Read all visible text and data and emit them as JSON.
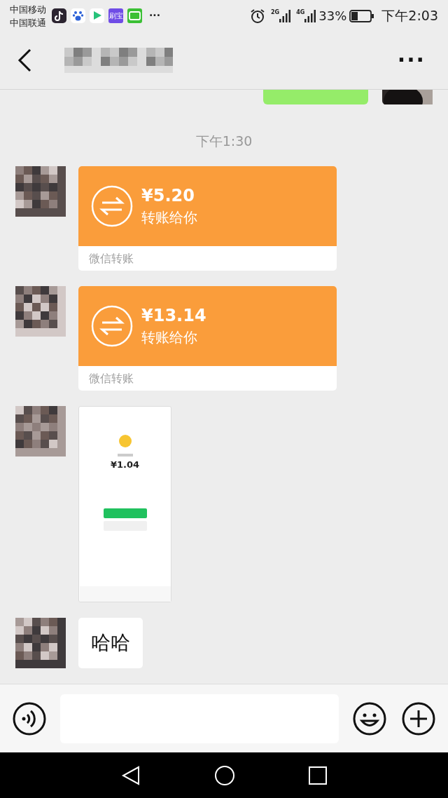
{
  "status_bar": {
    "carriers": [
      "中国移动",
      "中国联通"
    ],
    "apps": [
      {
        "kind": "music"
      },
      {
        "kind": "paw"
      },
      {
        "kind": "play"
      },
      {
        "kind": "label",
        "text": "刷宝"
      },
      {
        "kind": "tv"
      }
    ],
    "more": "···",
    "networks": [
      "2G",
      "4G"
    ],
    "battery": "33%",
    "time": "下午2:03"
  },
  "header": {
    "menu": "···"
  },
  "messages": [
    {
      "kind": "partial",
      "outgoing": true
    },
    {
      "kind": "time",
      "text": "下午1:30"
    },
    {
      "kind": "transfer",
      "outgoing": false,
      "amount": "¥5.20",
      "note": "转账给你",
      "footer": "微信转账"
    },
    {
      "kind": "transfer",
      "outgoing": false,
      "amount": "¥13.14",
      "note": "转账给你",
      "footer": "微信转账"
    },
    {
      "outgoing": false,
      "amount": "¥1.04"
    },
    {
      "kind": "text",
      "outgoing": false,
      "text": "哈哈"
    }
  ]
}
